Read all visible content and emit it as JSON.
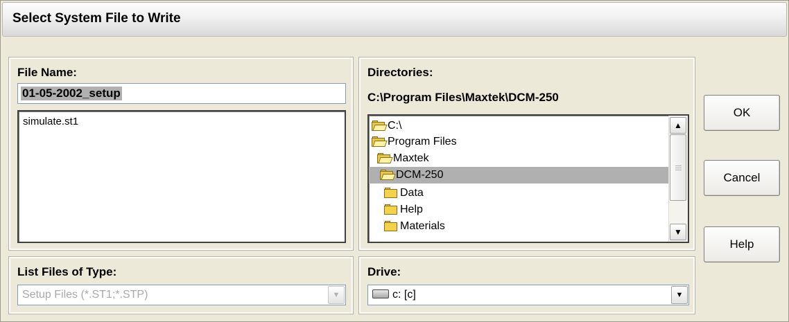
{
  "window": {
    "title": "Select System File to Write"
  },
  "file_name": {
    "label": "File Name:",
    "value": "01-05-2002_setup",
    "files": [
      "simulate.st1"
    ]
  },
  "directories": {
    "label": "Directories:",
    "current_path": "C:\\Program Files\\Maxtek\\DCM-250",
    "tree": [
      {
        "label": "C:\\",
        "icon": "open-folder-icon"
      },
      {
        "label": "Program Files",
        "icon": "open-folder-icon"
      },
      {
        "label": "Maxtek",
        "icon": "open-folder-icon"
      },
      {
        "label": "DCM-250",
        "icon": "open-folder-icon",
        "selected": true
      },
      {
        "label": "Data",
        "icon": "folder-icon"
      },
      {
        "label": "Help",
        "icon": "folder-icon"
      },
      {
        "label": "Materials",
        "icon": "folder-icon"
      }
    ]
  },
  "file_type": {
    "label": "List Files of Type:",
    "value": "Setup Files (*.ST1;*.STP)",
    "disabled": true
  },
  "drive": {
    "label": "Drive:",
    "value": "c: [c]",
    "icon": "drive-icon"
  },
  "buttons": {
    "ok": "OK",
    "cancel": "Cancel",
    "help": "Help"
  },
  "icons": {
    "scroll_up": "▲",
    "scroll_down": "▼",
    "dropdown": "▼"
  }
}
